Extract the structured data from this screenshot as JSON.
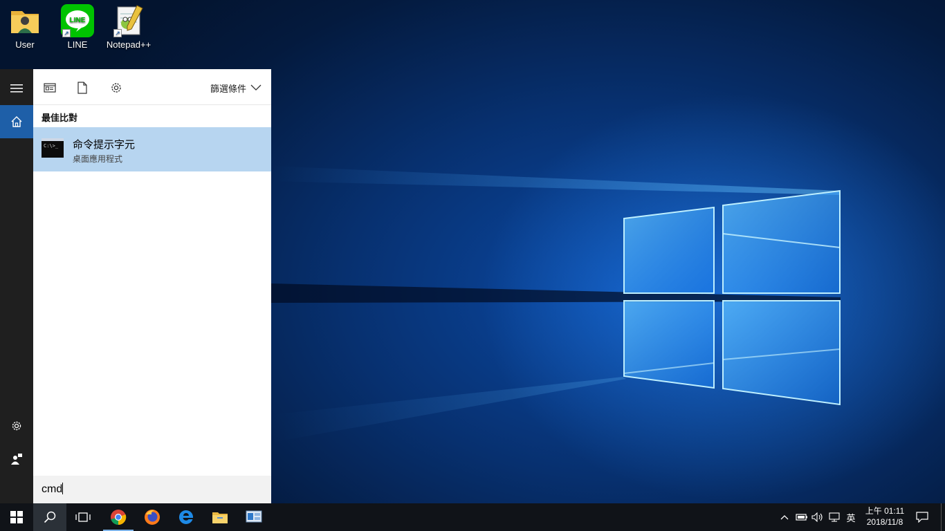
{
  "desktop": {
    "icons": [
      {
        "label": "User"
      },
      {
        "label": "LINE"
      },
      {
        "label": "Notepad++"
      }
    ]
  },
  "search": {
    "filter_label": "篩選條件",
    "section_heading": "最佳比對",
    "best_match": {
      "title": "命令提示字元",
      "subtitle": "桌面應用程式",
      "icon_text": "C:\\>_"
    },
    "query": "cmd"
  },
  "line_icon_text": "LINE",
  "taskbar": {
    "ime_label": "英",
    "time": "上午 01:11",
    "date": "2018/11/8"
  }
}
